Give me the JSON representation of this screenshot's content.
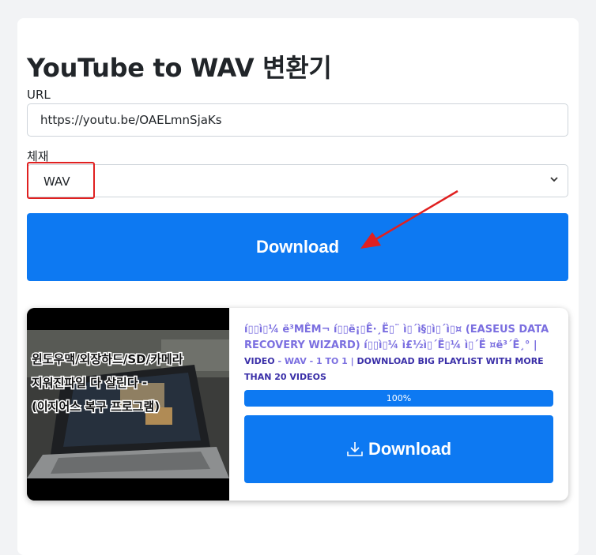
{
  "page": {
    "title": "YouTube to WAV 변환기"
  },
  "form": {
    "url_label": "URL",
    "url_value": "https://youtu.be/OAELmnSjaKs",
    "format_label": "체재",
    "format_value": "WAV",
    "download_label": "Download"
  },
  "result": {
    "video_title": "í▯▯ì▯¼ ë³MÊM¬ í▯▯ë¡▯Ê·¸Ë▯¨ ì▯´ì§▯ì▯´ì▯¤ (EASEUS DATA RECOVERY WIZARD) í▯▯ì▯¼ ì£½ì▯´Ë▯¼ ì▯´Ë ¤ë³´Ê¸° |",
    "meta_video": "VIDEO",
    "meta_sep": " - WAV - 1 TO 1 | ",
    "meta_link": "DOWNLOAD BIG PLAYLIST WITH MORE THAN 20 VIDEOS",
    "progress_text": "100%",
    "progress_value": 1.0,
    "download_label": "Download",
    "thumbnail_caption_lines": [
      "윈도우맥/외장하드/SD/카메라",
      "지워진파일 다 살린다 -",
      "(이지어스 복구 프로그램)"
    ]
  },
  "colors": {
    "primary": "#0d79f2",
    "highlight": "#e02020",
    "title_link": "#7b6fe0"
  }
}
